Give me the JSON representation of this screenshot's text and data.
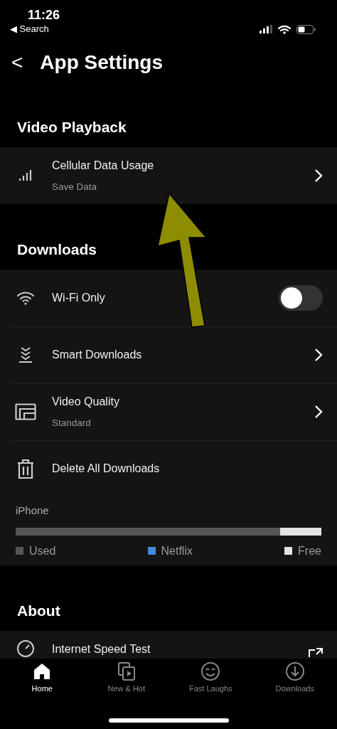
{
  "status_bar": {
    "time": "11:26",
    "back_link": "◀ Search"
  },
  "header": {
    "back": "<",
    "title": "App Settings"
  },
  "sections": [
    {
      "title": "Video Playback",
      "rows": [
        {
          "kind": "link",
          "label": "Cellular Data Usage",
          "sublabel": "Save Data"
        }
      ]
    },
    {
      "title": "Downloads",
      "rows": [
        {
          "kind": "toggle",
          "label": "Wi-Fi Only",
          "on": false
        },
        {
          "kind": "link",
          "label": "Smart Downloads"
        },
        {
          "kind": "link",
          "label": "Video Quality",
          "sublabel": "Standard"
        },
        {
          "kind": "action",
          "label": "Delete All Downloads"
        }
      ],
      "storage": {
        "device": "iPhone",
        "segments": [
          {
            "label": "Used",
            "color": "#555555",
            "level": 0.865
          },
          {
            "label": "Netflix",
            "color": "#3f8ae0"
          },
          {
            "label": "Free",
            "color": "#e3e3e3",
            "level": 0.135
          }
        ]
      }
    },
    {
      "title": "About",
      "rows": [
        {
          "kind": "external",
          "label": "Internet Speed Test"
        }
      ]
    }
  ],
  "annotation_arrow": {
    "shown": true
  },
  "tab_bar": [
    {
      "label": "Home",
      "selected": true
    },
    {
      "label": "New & Hot",
      "selected": false
    },
    {
      "label": "Fast Laughs",
      "selected": false
    },
    {
      "label": "Downloads",
      "selected": false
    }
  ]
}
